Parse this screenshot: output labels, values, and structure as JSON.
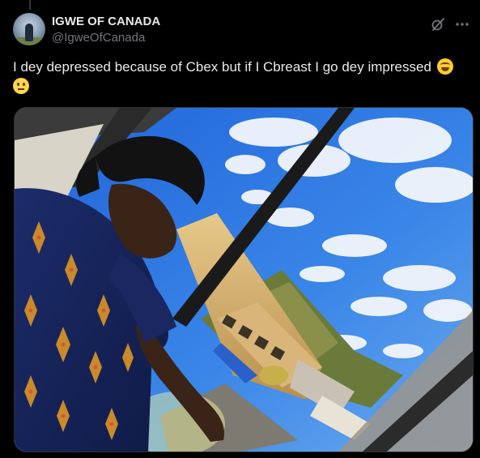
{
  "post": {
    "author_name": "IGWE OF CANADA",
    "author_handle": "@IgweOfCanada",
    "text": "I dey depressed because of Cbex but if I Cbreast I go dey impressed",
    "emojis": [
      "face-with-tears-of-joy",
      "neutral-face"
    ],
    "icons": {
      "grok": "grok-icon",
      "more": "more-icon"
    }
  },
  "media": {
    "alt_description_icon": "photo"
  },
  "colors": {
    "background": "#000000",
    "text": "#e7e9ea",
    "secondary": "#71767b",
    "border": "#2f3336"
  }
}
